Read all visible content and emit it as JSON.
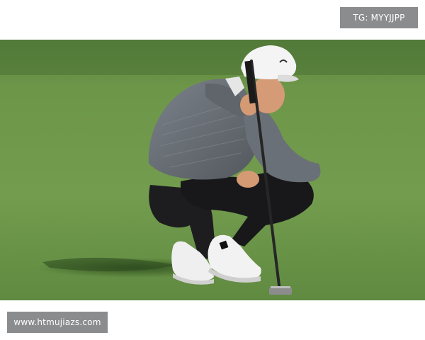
{
  "watermarks": {
    "top_right": "TG: MYYJJPP",
    "bottom_left": "www.htmujiazs.com"
  },
  "photo": {
    "subject": "golfer-crouching-reading-putt",
    "colors": {
      "grass_light": "#6f9a4c",
      "grass_dark": "#4f7d35",
      "sweater": "#6e7379",
      "pants": "#1c1c1e",
      "cap": "#f2f2f2",
      "skin": "#d9a07b",
      "shoes": "#f0f0f0",
      "putter": "#2a2a2a"
    }
  }
}
